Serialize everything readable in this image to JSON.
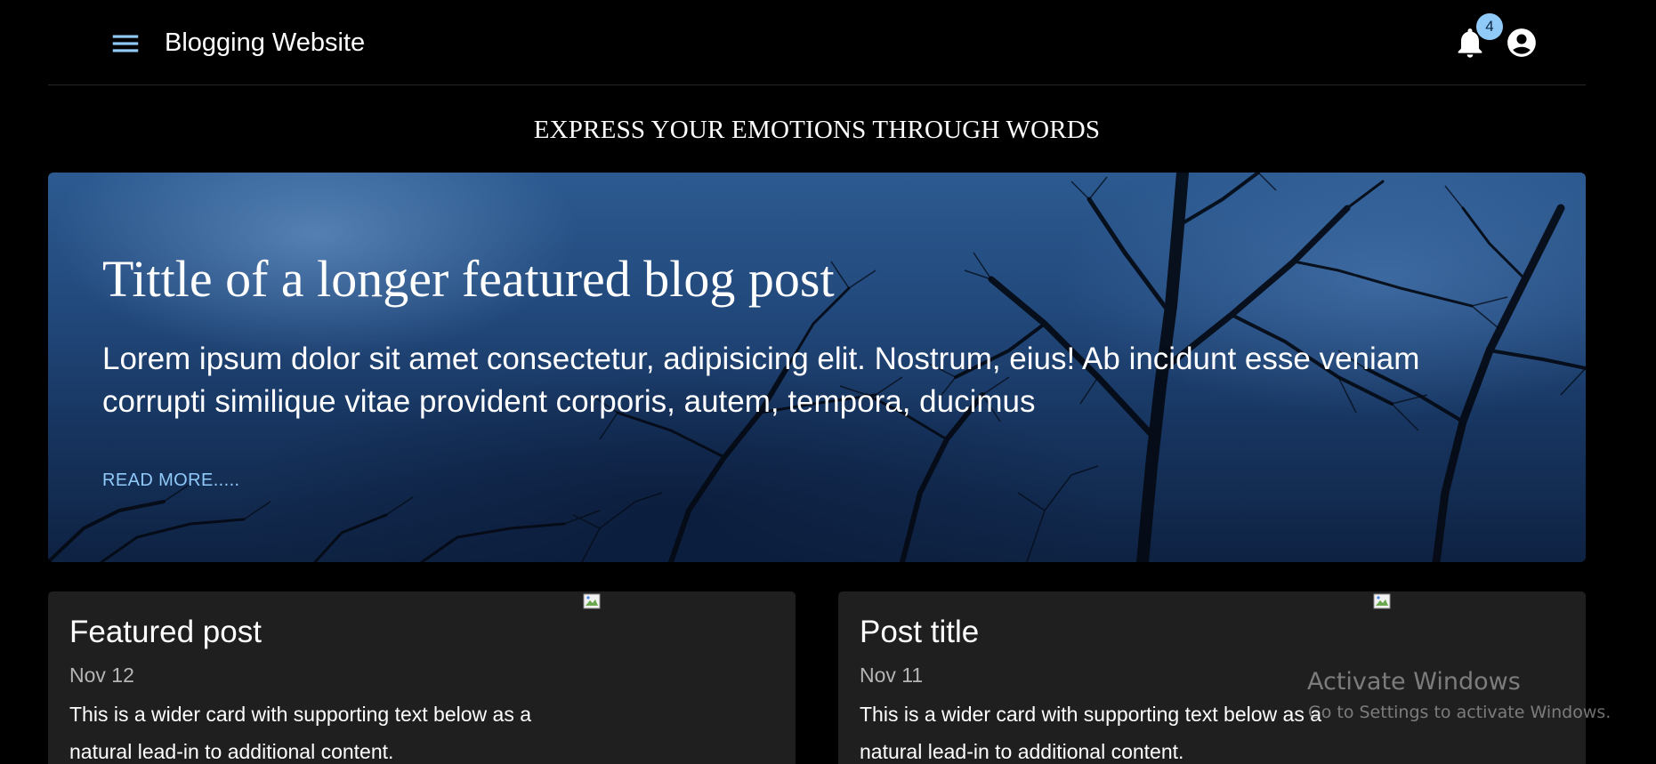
{
  "header": {
    "title": "Blogging Website",
    "notification_count": "4",
    "menu_icon": "menu-icon",
    "notification_icon": "bell-icon",
    "account_icon": "account-circle-icon"
  },
  "tagline": "EXPRESS YOUR EMOTIONS THROUGH WORDS",
  "hero": {
    "title": "Tittle of a longer featured blog post",
    "description": "Lorem ipsum dolor sit amet consectetur, adipisicing elit. Nostrum, eius! Ab incidunt esse veniam corrupti similique vitae provident corporis, autem, tempora, ducimus",
    "link_label": "READ MORE....."
  },
  "posts": [
    {
      "title": "Featured post",
      "date": "Nov 12",
      "text": "This is a wider card with supporting text below as a natural lead-in to additional content."
    },
    {
      "title": "Post title",
      "date": "Nov 11",
      "text": "This is a wider card with supporting text below as a natural lead-in to additional content."
    }
  ],
  "watermark": {
    "title": "Activate Windows",
    "subtitle": "Go to Settings to activate Windows."
  },
  "colors": {
    "background": "#000000",
    "card": "#1f1f1f",
    "accent": "#90caf9",
    "hero_sky": "#22497c"
  }
}
